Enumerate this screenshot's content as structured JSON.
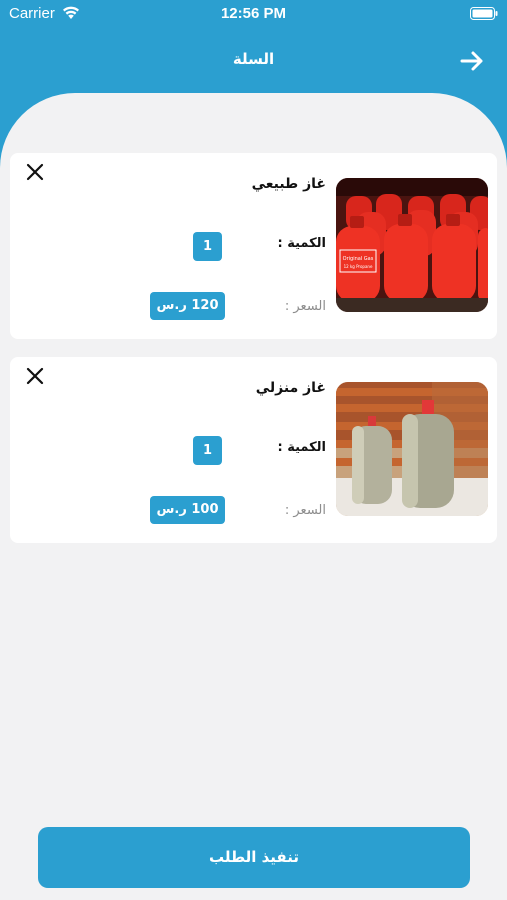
{
  "status_bar": {
    "carrier": "Carrier",
    "time": "12:56 PM"
  },
  "header": {
    "title": "السلة",
    "back_icon": "arrow-right-icon"
  },
  "cart": {
    "items": [
      {
        "name": "غاز طبيعي",
        "quantity_label": "الكمية :",
        "quantity": "1",
        "price_label": "السعر :",
        "price": "120 ر.س",
        "image": "red-gas-cylinders-photo",
        "image_print": "Original Gas",
        "image_print_2": "12 kg Propane"
      },
      {
        "name": "غاز منزلي",
        "quantity_label": "الكمية :",
        "quantity": "1",
        "price_label": "السعر :",
        "price": "100 ر.س",
        "image": "grey-gas-cylinders-photo"
      }
    ]
  },
  "footer": {
    "checkout_label": "تنفيذ الطلب"
  },
  "colors": {
    "primary": "#2b9fd0",
    "background": "#f2f2f3",
    "card": "#ffffff"
  }
}
